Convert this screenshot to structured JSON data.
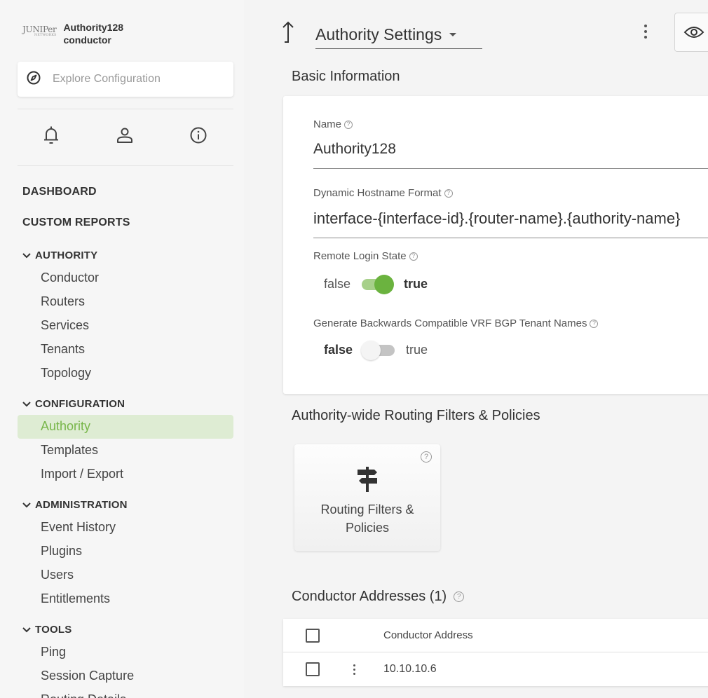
{
  "brand": {
    "logo": "JUNIPer",
    "logo_sub": "NETWORKS",
    "name": "Authority128",
    "role": "conductor"
  },
  "search": {
    "placeholder": "Explore Configuration"
  },
  "sidebar_icons": [
    "bell-icon",
    "user-icon",
    "info-icon"
  ],
  "nav": {
    "dashboard": "DASHBOARD",
    "custom_reports": "CUSTOM REPORTS",
    "authority": {
      "title": "AUTHORITY",
      "items": [
        "Conductor",
        "Routers",
        "Services",
        "Tenants",
        "Topology"
      ]
    },
    "configuration": {
      "title": "CONFIGURATION",
      "items": [
        "Authority",
        "Templates",
        "Import / Export"
      ],
      "active": "Authority"
    },
    "administration": {
      "title": "ADMINISTRATION",
      "items": [
        "Event History",
        "Plugins",
        "Users",
        "Entitlements"
      ]
    },
    "tools": {
      "title": "TOOLS",
      "items": [
        "Ping",
        "Session Capture",
        "Routing Details"
      ]
    }
  },
  "header": {
    "title": "Authority Settings"
  },
  "basic_info": {
    "title": "Basic Information",
    "name_label": "Name",
    "name_value": "Authority128",
    "hostname_label": "Dynamic Hostname Format",
    "hostname_value": "interface-{interface-id}.{router-name}.{authority-name}",
    "remote_login_label": "Remote Login State",
    "remote_login_value": true,
    "vrf_label": "Generate Backwards Compatible VRF BGP Tenant Names",
    "vrf_value": false,
    "false_label": "false",
    "true_label": "true"
  },
  "routing": {
    "title": "Authority-wide Routing Filters & Policies",
    "card_line1": "Routing Filters &",
    "card_line2": "Policies"
  },
  "conductor_addresses": {
    "title": "Conductor Addresses (1)",
    "column": "Conductor Address",
    "rows": [
      "10.10.10.6"
    ]
  },
  "colors": {
    "accent": "#6bb33f",
    "active_bg": "#deecd3",
    "active_text": "#78b64a"
  }
}
